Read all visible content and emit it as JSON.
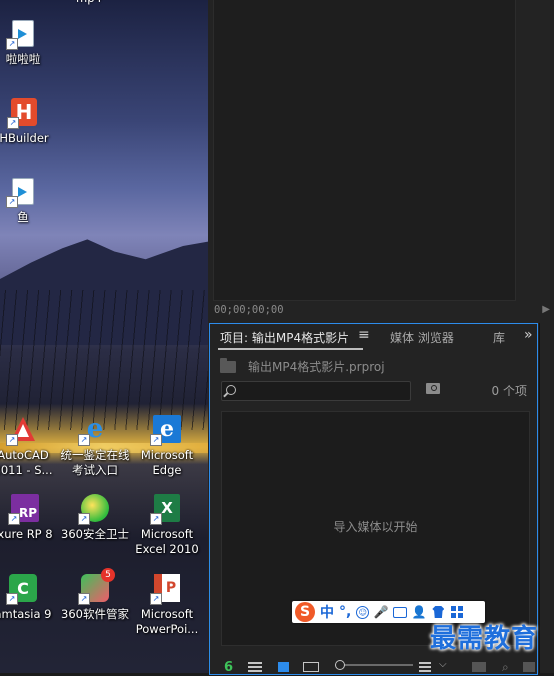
{
  "desktop": {
    "icons": [
      {
        "label": "啦啦啦",
        "icon": "video-file-icon"
      },
      {
        "label": "HBuilder",
        "icon": "hbuilder-icon"
      },
      {
        "label": "鱼",
        "icon": "video-file-icon"
      },
      {
        "label_l1": "AutoCAD",
        "label_l2": "2011 - S...",
        "icon": "autocad-icon"
      },
      {
        "label_l1": "统一鉴定在线",
        "label_l2": "考试入口",
        "icon": "ie-icon"
      },
      {
        "label_l1": "Microsoft",
        "label_l2": "Edge",
        "icon": "edge-icon"
      },
      {
        "label": "xure RP 8",
        "icon": "axure-icon",
        "glyph": "RP"
      },
      {
        "label": "360安全卫士",
        "icon": "360-safe-icon"
      },
      {
        "label_l1": "Microsoft",
        "label_l2": "Excel 2010",
        "icon": "excel-icon",
        "glyph": "X"
      },
      {
        "label": "amtasia 9",
        "icon": "camtasia-icon",
        "glyph": "C"
      },
      {
        "label": "360软件管家",
        "icon": "360-software-manager-icon",
        "badge": "5"
      },
      {
        "label_l1": "Microsoft",
        "label_l2": "PowerPoi...",
        "icon": "powerpoint-icon",
        "glyph": "P"
      }
    ],
    "partial_top_label": "mp4"
  },
  "program_monitor": {
    "timecode": "00;00;00;00",
    "play_glyph": "▶"
  },
  "project_panel": {
    "tab_project": "项目: 输出MP4格式影片",
    "tab_menu_glyph": "≡",
    "tab_media_browser": "媒体 浏览器",
    "tab_libraries": "库",
    "tabs_overflow_glyph": "»",
    "project_file": "输出MP4格式影片.prproj",
    "search_value": "",
    "item_count": "0 个项",
    "empty_message": "导入媒体以开始",
    "lock_glyph": "6",
    "sort_dropdown_glyph": "⌵",
    "new_search_bin_glyph": "⌕"
  },
  "ime": {
    "logo": "S",
    "lang": "中",
    "punct": "°,",
    "emoji_glyph": "☺",
    "mic_glyph": "🎤",
    "user_glyph": "👤"
  },
  "watermark": "最需教育",
  "colors": {
    "accent_blue": "#2d8ceb",
    "panel_bg": "#232323",
    "ime_blue": "#1a67d6",
    "sogou_orange": "#f05a28"
  }
}
